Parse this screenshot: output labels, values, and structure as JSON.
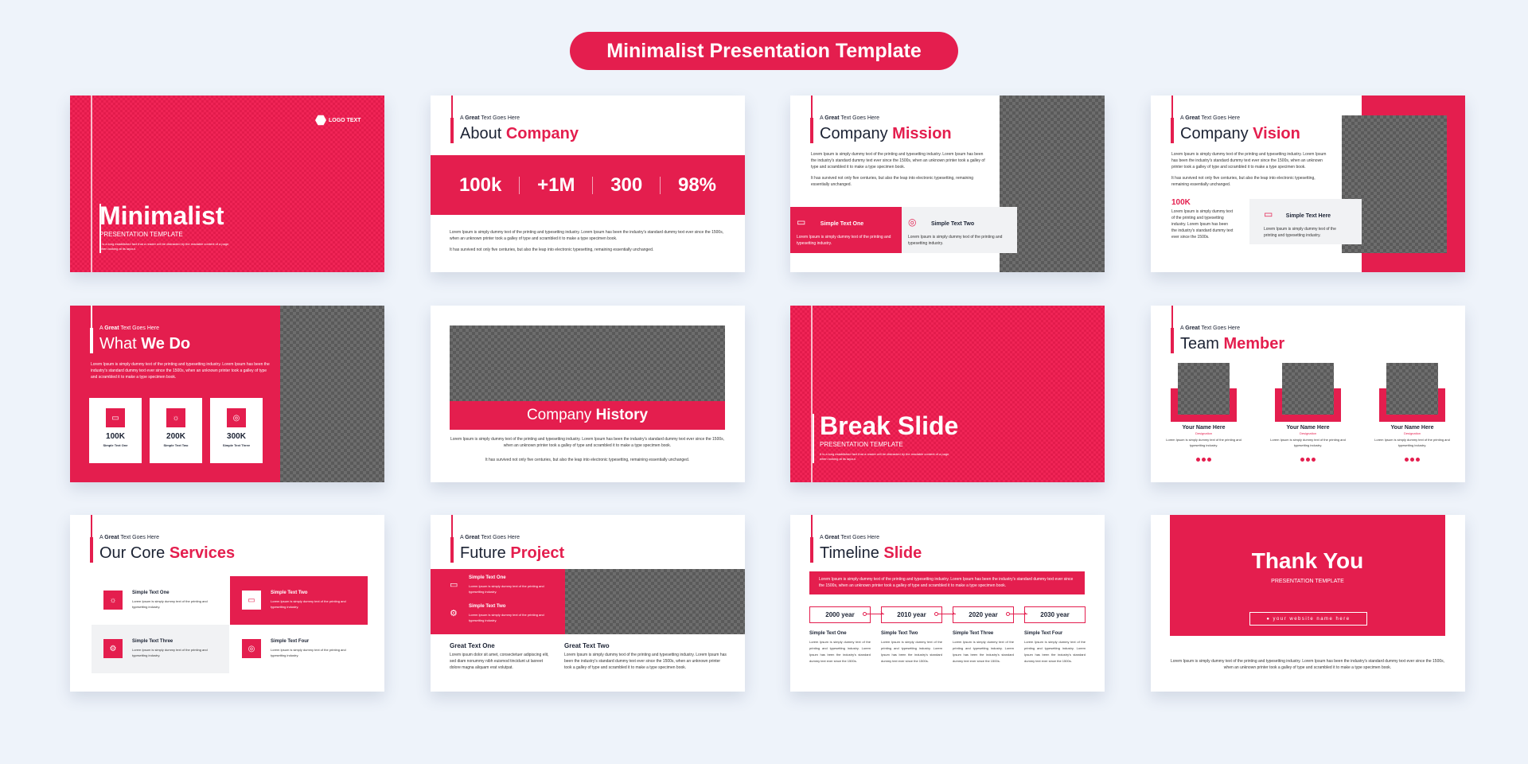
{
  "header": {
    "title": "Minimalist Presentation Template"
  },
  "colors": {
    "accent": "#e41e4e",
    "dark": "#1b2233",
    "placeholder": "#6d6d6d",
    "background": "#eef3fa"
  },
  "kicker": {
    "pre": "A",
    "bold": "Great",
    "post": "Text Goes Here"
  },
  "lorem_short": "Lorem Ipsum is simply dummy text of the printing and typesetting industry.",
  "lorem_long": "Lorem Ipsum is simply dummy text of the printing and typesetting industry. Lorem Ipsum has been the industry's standard dummy text ever since the 1500s, when an unknown printer took a galley of type and scrambled it to make a type specimen book.",
  "lorem_survived": "It has survived not only five centuries, but also the leap into electronic typesetting, remaining essentially unchanged.",
  "slides": {
    "cover": {
      "logo": "LOGO TEXT",
      "logo_icon": "drop-icon",
      "title": "Minimalist",
      "subtitle": "PRESENTATION TEMPLATE",
      "desc": "It is a long established fact that a reader will be distracted by the readable content of a page when looking at its layout."
    },
    "about": {
      "title_a": "About",
      "title_b": "Company",
      "stats": [
        "100k",
        "+1M",
        "300",
        "98%"
      ]
    },
    "mission": {
      "title_a": "Company",
      "title_b": "Mission",
      "card1": {
        "icon": "chart-monitor-icon",
        "title": "Simple Text One"
      },
      "card2": {
        "icon": "target-icon",
        "title": "Simple Text Two"
      }
    },
    "vision": {
      "title_a": "Company",
      "title_b": "Vision",
      "stat": "100K",
      "stat_desc": "Lorem Ipsum is simply dummy text of the printing and typesetting industry. Lorem Ipsum has been the industry's standard dummy text ever since the 1500s.",
      "card": {
        "icon": "chart-monitor-icon",
        "title": "Simple Text Here"
      }
    },
    "whatwedo": {
      "title_a": "What",
      "title_b": "We Do",
      "boxes": [
        {
          "icon": "chart-monitor-icon",
          "value": "100K",
          "label": "Simple Text One"
        },
        {
          "icon": "lightbulb-icon",
          "value": "200K",
          "label": "Simple Text Two"
        },
        {
          "icon": "target-icon",
          "value": "300K",
          "label": "Simple Text Three"
        }
      ]
    },
    "history": {
      "title_a": "Company",
      "title_b": "History"
    },
    "break": {
      "title": "Break Slide",
      "subtitle": "PRESENTATION TEMPLATE",
      "desc": "It is a long established fact that a reader will be distracted by the readable content of a page when looking at its layout."
    },
    "team": {
      "title_a": "Team",
      "title_b": "Member",
      "members": [
        {
          "name": "Your Name Here",
          "role": "Designation",
          "desc": "Lorem Ipsum is simply dummy text of the printing and typesetting industry."
        },
        {
          "name": "Your Name Here",
          "role": "Designation",
          "desc": "Lorem Ipsum is simply dummy text of the printing and typesetting industry."
        },
        {
          "name": "Your Name Here",
          "role": "Designation",
          "desc": "Lorem Ipsum is simply dummy text of the printing and typesetting industry."
        }
      ]
    },
    "services": {
      "title_a": "Our Core",
      "title_b": "Services",
      "items": [
        {
          "icon": "lightbulb-icon",
          "title": "Simple Text One"
        },
        {
          "icon": "chart-monitor-icon",
          "title": "Simple Text Two"
        },
        {
          "icon": "gears-icon",
          "title": "Simple Text Three"
        },
        {
          "icon": "target-icon",
          "title": "Simple Text Four"
        }
      ]
    },
    "future": {
      "title_a": "Future",
      "title_b": "Project",
      "items": [
        {
          "icon": "chart-monitor-icon",
          "title": "Simple Text One"
        },
        {
          "icon": "gears-icon",
          "title": "Simple Text Two"
        }
      ],
      "col1": {
        "title": "Great Text One",
        "text": "Lorem ipsum dolor sit amet, consectetuer adipiscing elit, sed diam nonummy nibh euismod tincidunt ut laoreet dolore magna aliquam erat volutpat."
      },
      "col2": {
        "title": "Great Text Two"
      }
    },
    "timeline": {
      "title_a": "Timeline",
      "title_b": "Slide",
      "years": [
        "2000 year",
        "2010 year",
        "2020 year",
        "2030 year"
      ],
      "items": [
        "Simple Text One",
        "Simple Text Two",
        "Simple Text Three",
        "Simple Text Four"
      ],
      "item_desc": "Lorem Ipsum is simply dummy text of the printing and typesetting industry. Lorem Ipsum has been the industry's standard dummy text ever since the 1500s."
    },
    "thanks": {
      "title": "Thank You",
      "subtitle": "PRESENTATION TEMPLATE",
      "website": "your website name here",
      "website_icon": "globe-icon"
    }
  }
}
